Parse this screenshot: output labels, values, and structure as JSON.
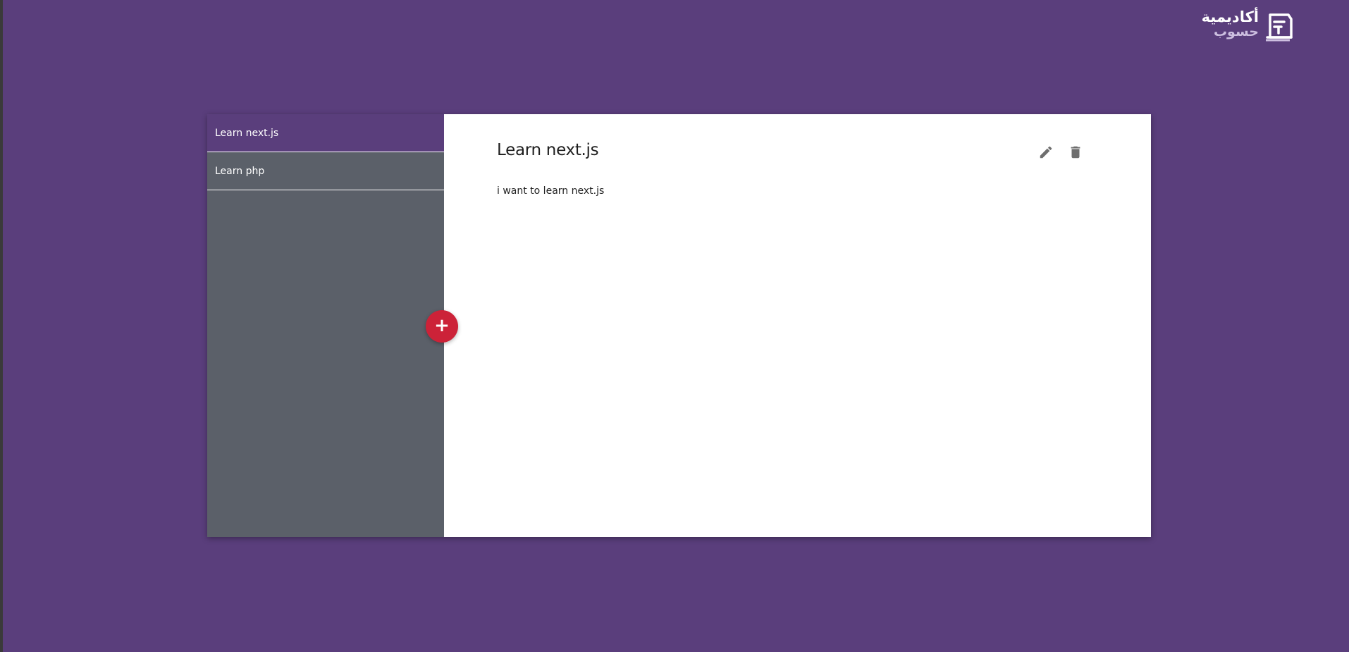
{
  "logo": {
    "line1": "أكاديمية",
    "line2": "حسوب",
    "icon": "hsoub-logo-icon"
  },
  "sidebar": {
    "items": [
      {
        "label": "Learn next.js",
        "active": true
      },
      {
        "label": "Learn php",
        "active": false
      }
    ]
  },
  "note": {
    "title": "Learn next.js",
    "body": "i want to learn next.js"
  },
  "actions": {
    "edit_icon": "pencil-icon",
    "delete_icon": "trash-icon"
  },
  "add_button": {
    "label": "+"
  },
  "colors": {
    "background": "#5a3e7c",
    "sidebar": "#5b6069",
    "active_item": "#5a3e7c",
    "accent": "#cc2238",
    "icon": "#6e6e6e"
  }
}
